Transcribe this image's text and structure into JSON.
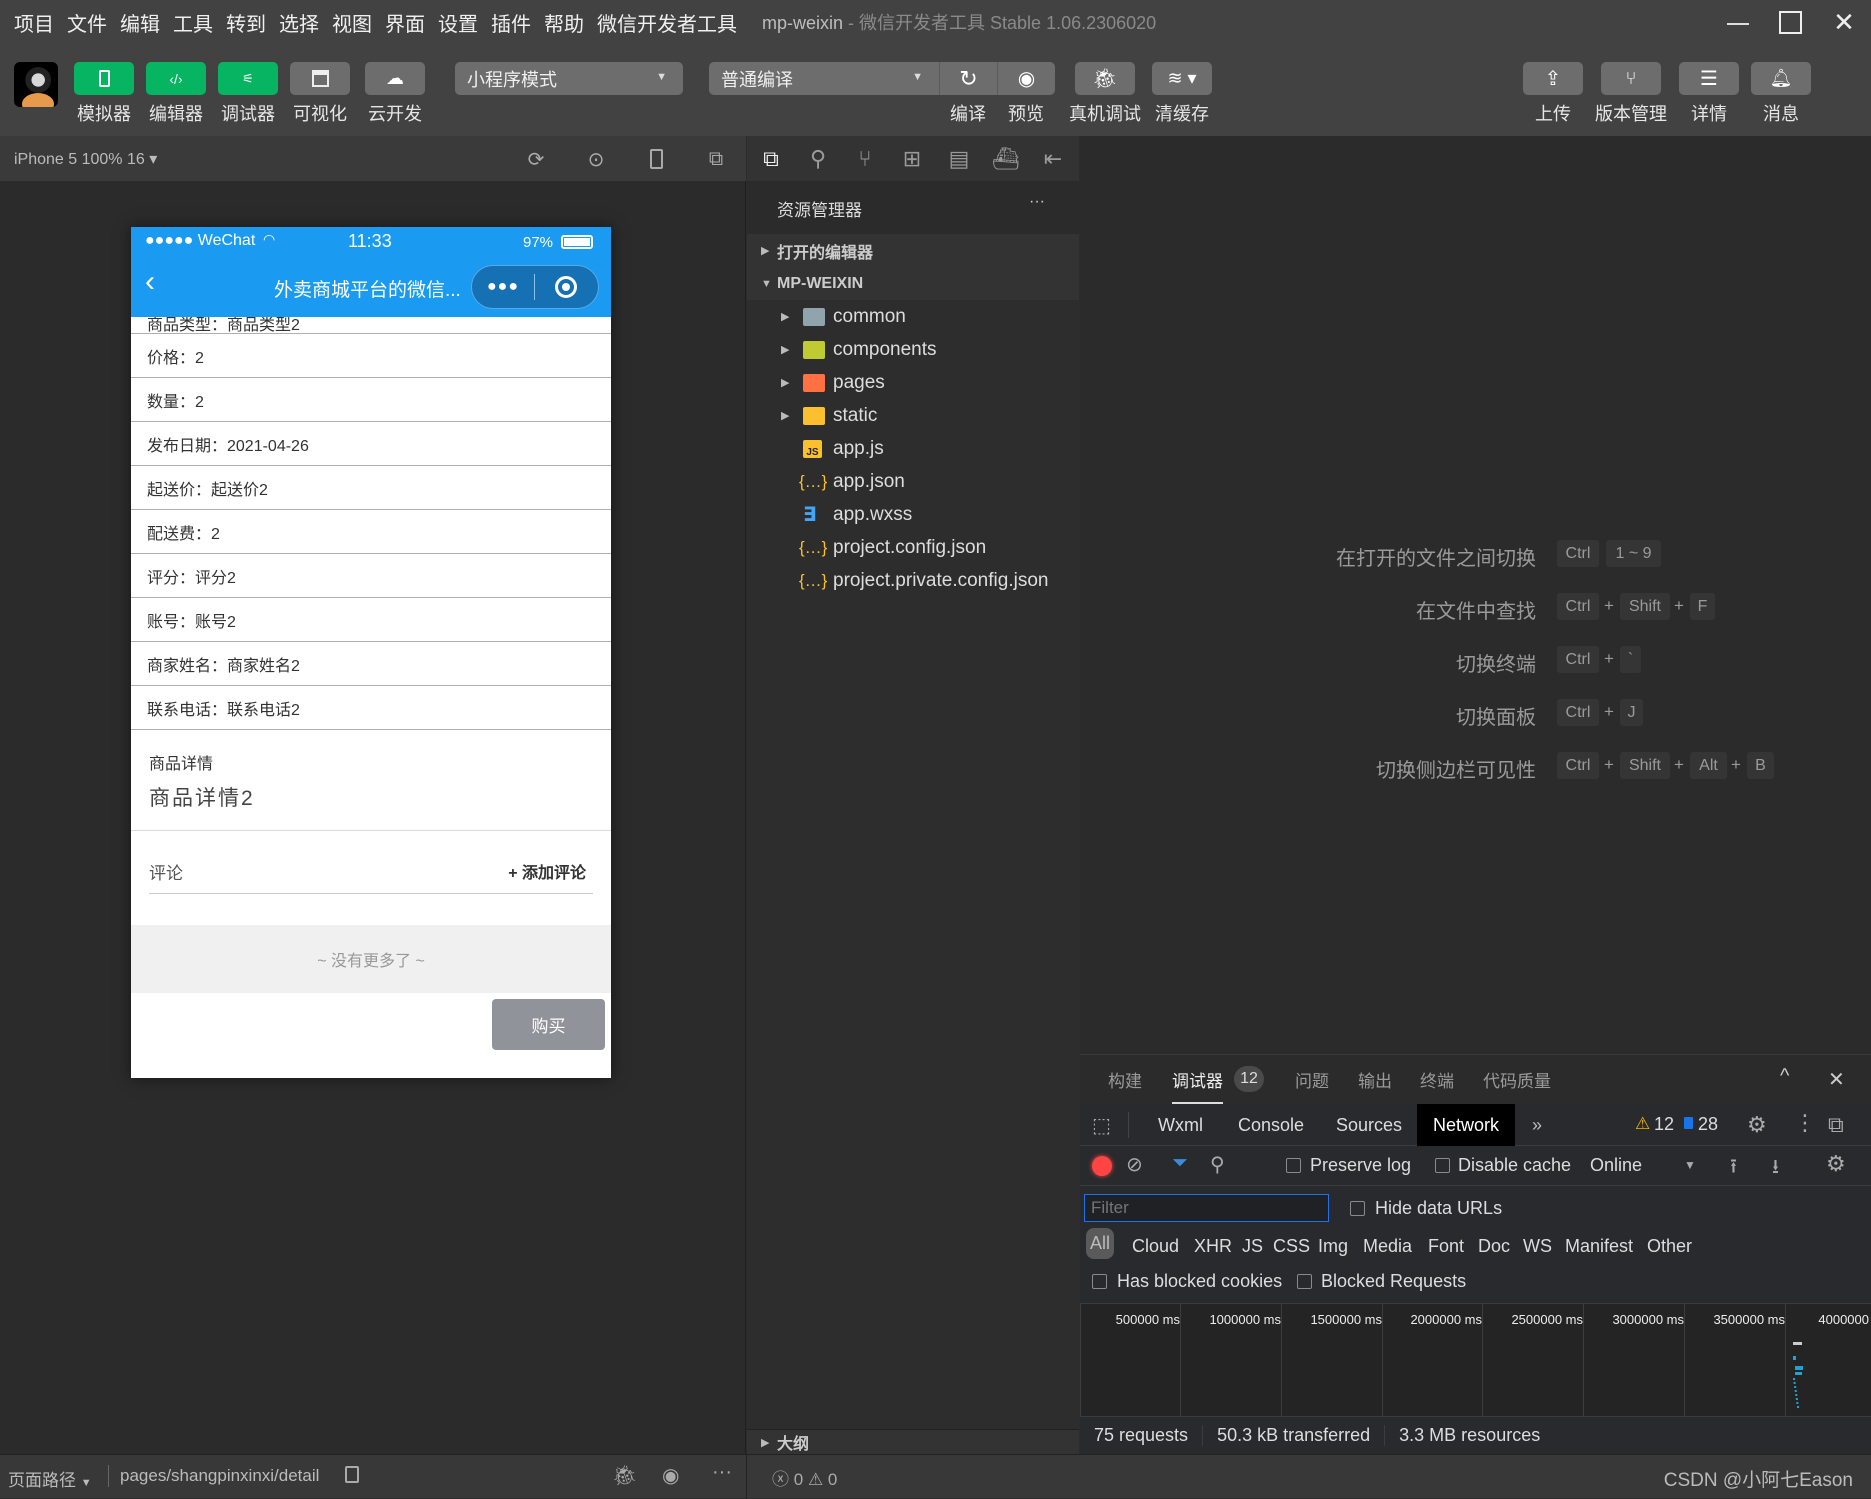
{
  "menubar": {
    "items": [
      "项目",
      "文件",
      "编辑",
      "工具",
      "转到",
      "选择",
      "视图",
      "界面",
      "设置",
      "插件",
      "帮助",
      "微信开发者工具"
    ],
    "window_title_project": "mp-weixin",
    "window_title_rest": " - 微信开发者工具 Stable 1.06.2306020"
  },
  "toolbar": {
    "simulator": "模拟器",
    "editor": "编辑器",
    "debugger": "调试器",
    "visualize": "可视化",
    "cloud": "云开发",
    "mode_select": "小程序模式",
    "compile_select": "普通编译",
    "compile": "编译",
    "preview": "预览",
    "real_debug": "真机调试",
    "clear_cache": "清缓存",
    "upload": "上传",
    "version": "版本管理",
    "details": "详情",
    "messages": "消息"
  },
  "simulator": {
    "device_label": "iPhone 5 100% 16 ▾",
    "status": {
      "carrier": "●●●●● WeChat",
      "time": "11:33",
      "battery": "97%"
    },
    "nav_title": "外卖商城平台的微信...",
    "rows": [
      "商品类型：商品类型2",
      "价格：2",
      "数量：2",
      "发布日期：2021-04-26",
      "起送价：起送价2",
      "配送费：2",
      "评分：评分2",
      "账号：账号2",
      "商家姓名：商家姓名2",
      "联系电话：联系电话2"
    ],
    "detail_title": "商品详情",
    "detail_value": "商品详情2",
    "comments_label": "评论",
    "add_comment": "+ 添加评论",
    "no_more": "~ 没有更多了 ~",
    "buy_button": "购买"
  },
  "explorer": {
    "title": "资源管理器",
    "more": "···",
    "open_editors": "打开的编辑器",
    "project": "MP-WEIXIN",
    "tree": [
      {
        "name": "common",
        "type": "folder",
        "color": "#90a4ae"
      },
      {
        "name": "components",
        "type": "folder",
        "color": "#c0ca33"
      },
      {
        "name": "pages",
        "type": "folder",
        "color": "#ff7043"
      },
      {
        "name": "static",
        "type": "folder",
        "color": "#fbc02d"
      },
      {
        "name": "app.js",
        "type": "js"
      },
      {
        "name": "app.json",
        "type": "json"
      },
      {
        "name": "app.wxss",
        "type": "css"
      },
      {
        "name": "project.config.json",
        "type": "json"
      },
      {
        "name": "project.private.config.json",
        "type": "json"
      }
    ],
    "outline": "大纲"
  },
  "editor": {
    "shortcuts": [
      {
        "label": "在打开的文件之间切换",
        "keys": [
          "Ctrl",
          "1 ~ 9"
        ],
        "sep": ""
      },
      {
        "label": "在文件中查找",
        "keys": [
          "Ctrl",
          "Shift",
          "F"
        ],
        "sep": "+"
      },
      {
        "label": "切换终端",
        "keys": [
          "Ctrl",
          "`"
        ],
        "sep": "+"
      },
      {
        "label": "切换面板",
        "keys": [
          "Ctrl",
          "J"
        ],
        "sep": "+"
      },
      {
        "label": "切换侧边栏可见性",
        "keys": [
          "Ctrl",
          "Shift",
          "Alt",
          "B"
        ],
        "sep": "+"
      }
    ]
  },
  "debug": {
    "tabs": [
      "构建",
      "调试器",
      "问题",
      "输出",
      "终端",
      "代码质量"
    ],
    "debugger_badge": "12",
    "devtools_tabs": [
      "Wxml",
      "Console",
      "Sources",
      "Network"
    ],
    "more_tabs": "»",
    "warnings": "12",
    "messages": "28",
    "preserve_log": "Preserve log",
    "disable_cache": "Disable cache",
    "throttle": "Online",
    "filter_placeholder": "Filter",
    "hide_data_urls": "Hide data URLs",
    "types": [
      "All",
      "Cloud",
      "XHR",
      "JS",
      "CSS",
      "Img",
      "Media",
      "Font",
      "Doc",
      "WS",
      "Manifest",
      "Other"
    ],
    "has_blocked_cookies": "Has blocked cookies",
    "blocked_requests": "Blocked Requests",
    "timeline_ticks": [
      "500000 ms",
      "1000000 ms",
      "1500000 ms",
      "2000000 ms",
      "2500000 ms",
      "3000000 ms",
      "3500000 ms",
      "4000000"
    ],
    "requests": "75 requests",
    "transferred": "50.3 kB transferred",
    "resources": "3.3 MB resources"
  },
  "statusbar": {
    "page_path_label": "页面路径",
    "page_path": "pages/shangpinxinxi/detail",
    "errors": "0",
    "warnings": "0",
    "watermark": "CSDN @小阿七Eason"
  }
}
